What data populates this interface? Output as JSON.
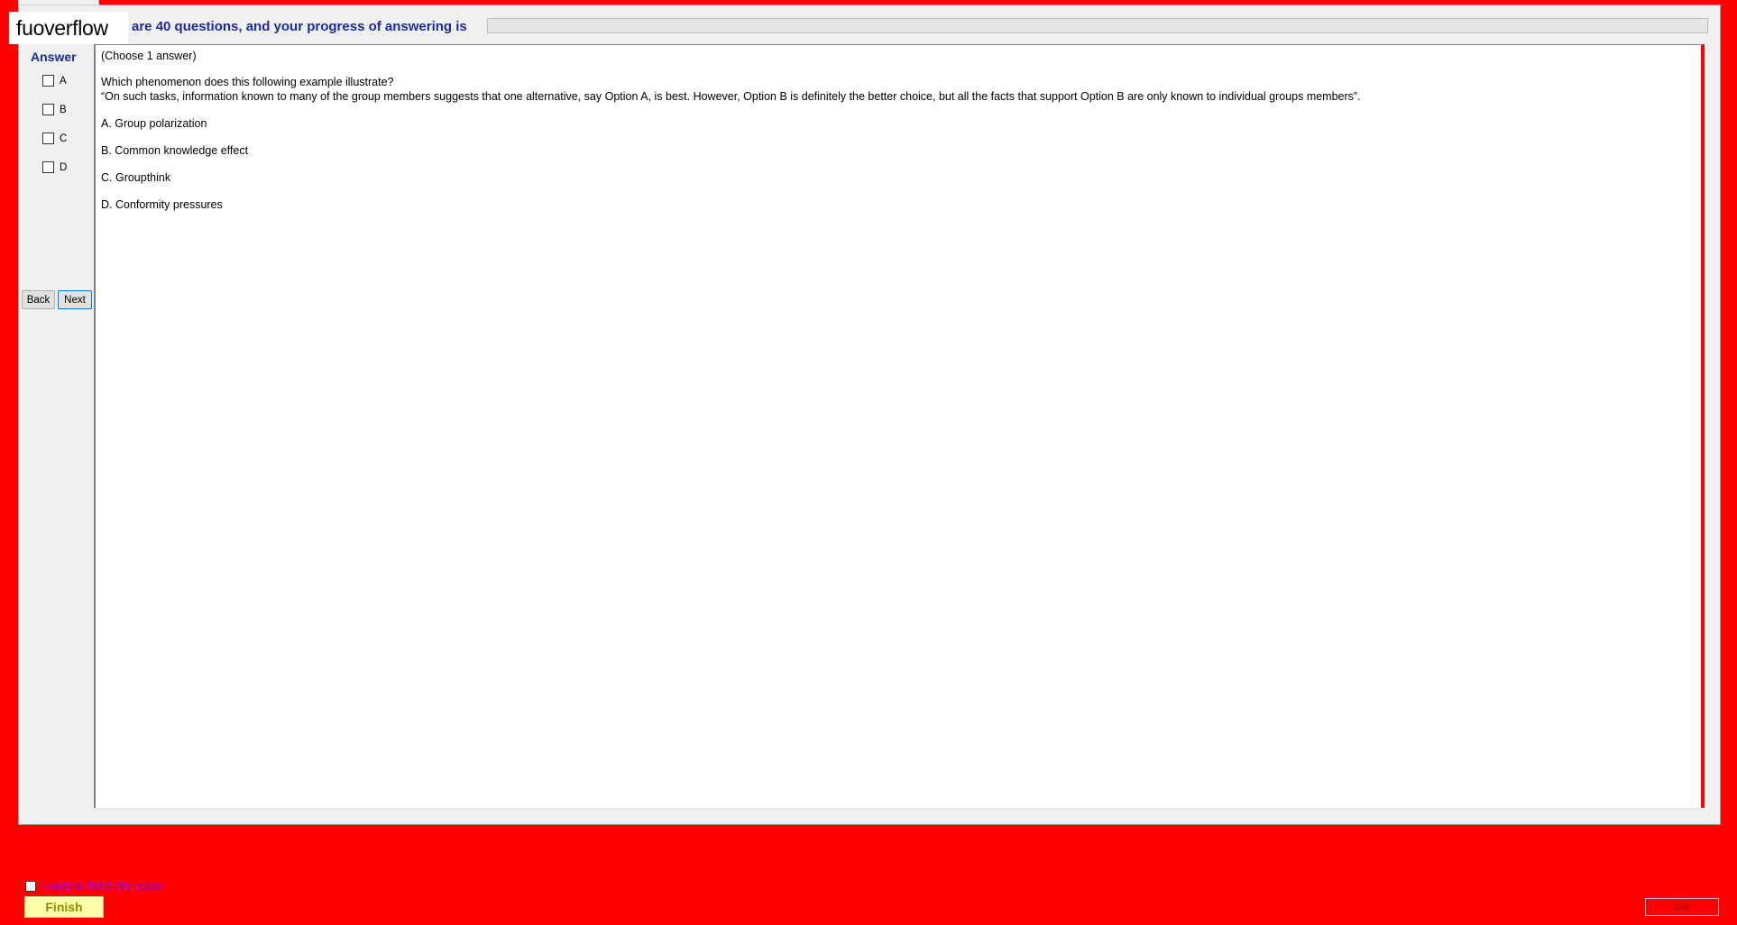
{
  "header": {
    "watermark": "fuoverflow",
    "status_text": "are 40 questions, and your progress of answering is",
    "progress_fraction": 0
  },
  "sidebar": {
    "heading": "Answer",
    "options": [
      {
        "letter": "A"
      },
      {
        "letter": "B"
      },
      {
        "letter": "C"
      },
      {
        "letter": "D"
      }
    ],
    "back_label": "Back",
    "next_label": "Next"
  },
  "question": {
    "instruction": "(Choose 1 answer)",
    "prompt": "Which phenomenon does this following example illustrate?",
    "scenario": "“On such tasks, information known to many of the group members suggests that one alternative, say Option A, is best. However, Option B is definitely the better choice, but all the facts that support Option B are only known to individual groups members”.",
    "choices": [
      {
        "text": "A.  Group polarization"
      },
      {
        "text": "B.  Common knowledge effect"
      },
      {
        "text": "C.  Groupthink"
      },
      {
        "text": "D.  Conformity pressures"
      }
    ]
  },
  "footer": {
    "finish_checkbox_label": "I want to finish the exam",
    "finish_label": "Finish",
    "exit_label": "Exit"
  },
  "colors": {
    "background": "#ff0000",
    "panel": "#f0f0f0",
    "heading_blue": "#1a2aa0",
    "finish_bg": "#ffffaa"
  }
}
